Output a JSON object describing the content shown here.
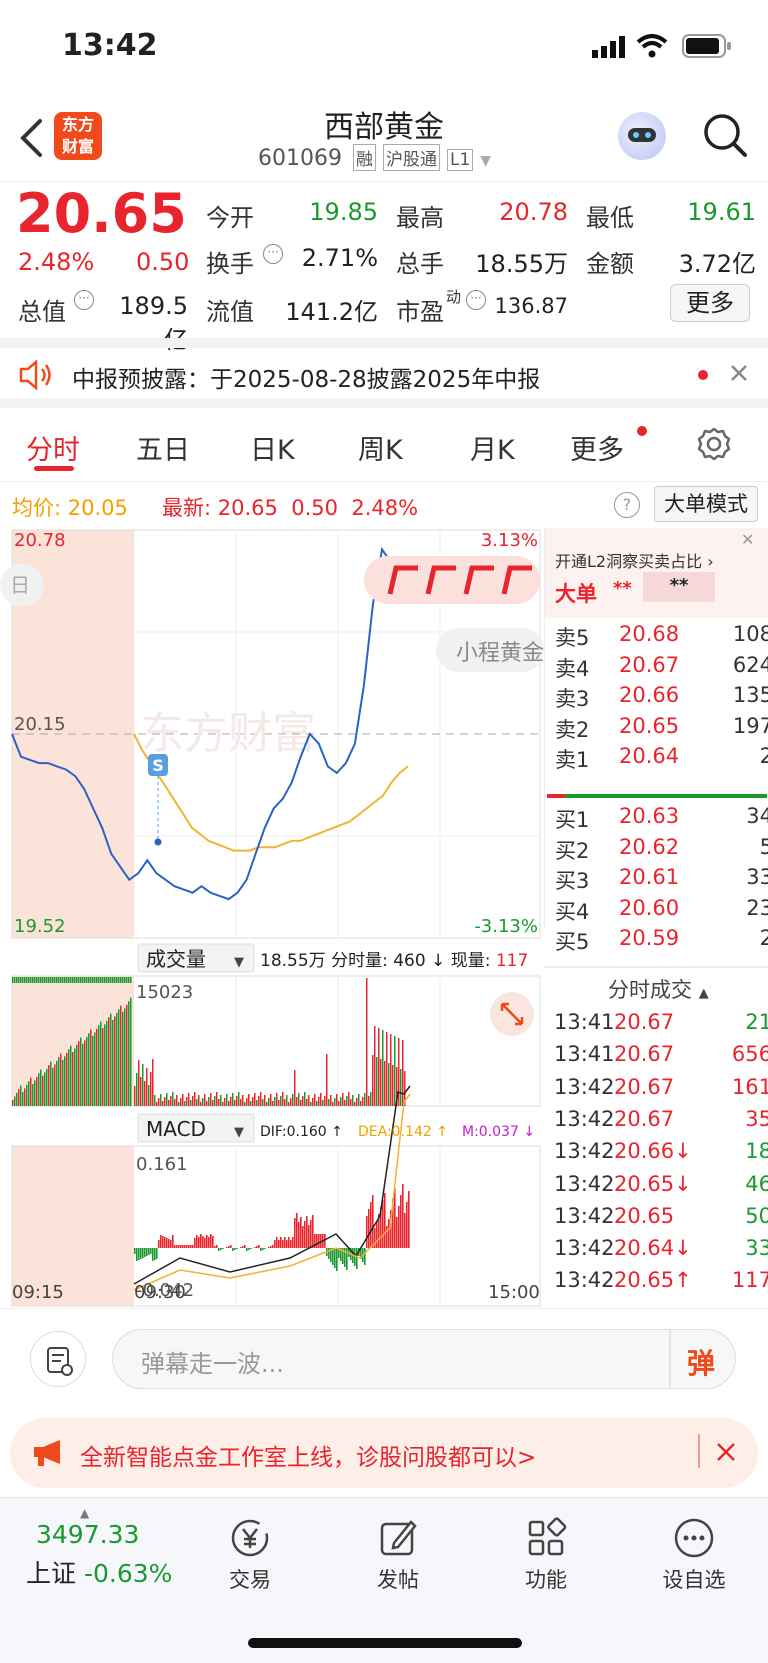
{
  "status": {
    "time": "13:42"
  },
  "nav": {
    "title": "西部黄金",
    "code": "601069",
    "tags": [
      "融",
      "沪股通",
      "L1"
    ],
    "logo_text_1": "东方",
    "logo_text_2": "财富"
  },
  "quote": {
    "price": "20.65",
    "change_pct": "2.48%",
    "change": "0.50",
    "open_label": "今开",
    "open": "19.85",
    "high_label": "最高",
    "high": "20.78",
    "low_label": "最低",
    "low": "19.61",
    "turnover_label": "换手",
    "turnover": "2.71%",
    "volume_label": "总手",
    "volume": "18.55万",
    "amount_label": "金额",
    "amount": "3.72亿",
    "mktcap_label": "总值",
    "mktcap": "189.5亿",
    "float_label": "流值",
    "float": "141.2亿",
    "pe_label": "市盈",
    "pe_sup": "动",
    "pe": "136.87",
    "more": "更多"
  },
  "notice": {
    "text": "中报预披露：于2025-08-28披露2025年中报"
  },
  "tabs": [
    "分时",
    "五日",
    "日K",
    "周K",
    "月K",
    "更多"
  ],
  "info": {
    "avg_label": "均价:",
    "avg": "20.05",
    "last_label": "最新:",
    "last": "20.65",
    "chg": "0.50",
    "pct": "2.48%",
    "mode": "大单模式"
  },
  "chart": {
    "y_top": "20.78",
    "y_mid": "20.15",
    "y_bot": "19.52",
    "pct_top": "3.13%",
    "pct_bot": "-3.13%",
    "badge": "S",
    "mini": "小程黄金",
    "watermark": "东方财富",
    "vol_select": "成交量",
    "vol_info": "18.55万 分时量: 460 ↓ 现量: ",
    "vol_now": "117",
    "vol_max": "15023",
    "macd_select": "MACD",
    "dif": "DIF:0.160 ↑",
    "dea": "DEA:0.142 ↑",
    "m": "M:0.037 ↓",
    "macd_top": "0.161",
    "macd_bot": "-0.042",
    "t_start": "09:15",
    "t_open": "09:30",
    "t_end": "15:00",
    "colors": {
      "price": "#2a63c5",
      "avg": "#f2b233",
      "up": "#e8242d",
      "down": "#1a9a2e"
    }
  },
  "chart_data": {
    "type": "line",
    "series": [
      {
        "values": [
          20.15,
          20.08,
          20.07,
          20.06,
          20.06,
          20.05,
          20.04,
          20.02,
          19.98,
          19.92,
          19.86,
          19.78,
          19.74,
          19.7,
          19.72,
          19.76,
          19.72,
          19.7,
          19.68,
          19.67,
          19.66,
          19.68,
          19.66,
          19.65,
          19.64,
          19.66,
          19.7,
          19.78,
          19.86,
          19.92,
          19.95,
          20.0,
          20.08,
          20.15,
          20.12,
          20.05,
          20.03,
          20.06,
          20.12,
          20.3,
          20.55,
          20.72,
          20.68,
          20.65
        ]
      },
      {
        "values": [
          20.15,
          20.1,
          20.06,
          20.02,
          19.98,
          19.94,
          19.9,
          19.86,
          19.84,
          19.82,
          19.81,
          19.8,
          19.79,
          19.79,
          19.79,
          19.8,
          19.8,
          19.8,
          19.81,
          19.82,
          19.82,
          19.83,
          19.84,
          19.85,
          19.86,
          19.87,
          19.88,
          19.9,
          19.92,
          19.94,
          19.96,
          20.0,
          20.03,
          20.05
        ]
      }
    ],
    "ylim": [
      19.52,
      20.78
    ]
  },
  "orderbook": {
    "header": "开通L2洞察买卖占比",
    "big_label": "大单",
    "big_a": "**",
    "big_b": "**",
    "asks": [
      {
        "label": "卖5",
        "price": "20.68",
        "vol": "108"
      },
      {
        "label": "卖4",
        "price": "20.67",
        "vol": "624"
      },
      {
        "label": "卖3",
        "price": "20.66",
        "vol": "135"
      },
      {
        "label": "卖2",
        "price": "20.65",
        "vol": "197"
      },
      {
        "label": "卖1",
        "price": "20.64",
        "vol": "2"
      }
    ],
    "bids": [
      {
        "label": "买1",
        "price": "20.63",
        "vol": "34"
      },
      {
        "label": "买2",
        "price": "20.62",
        "vol": "5"
      },
      {
        "label": "买3",
        "price": "20.61",
        "vol": "33"
      },
      {
        "label": "买4",
        "price": "20.60",
        "vol": "23"
      },
      {
        "label": "买5",
        "price": "20.59",
        "vol": "2"
      }
    ]
  },
  "trades": {
    "title": "分时成交",
    "rows": [
      {
        "time": "13:41",
        "price": "20.67",
        "vol": "21"
      },
      {
        "time": "13:41",
        "price": "20.67",
        "vol": "656"
      },
      {
        "time": "13:42",
        "price": "20.67",
        "vol": "161"
      },
      {
        "time": "13:42",
        "price": "20.67",
        "vol": "35"
      },
      {
        "time": "13:42",
        "price": "20.66↓",
        "vol": "18"
      },
      {
        "time": "13:42",
        "price": "20.65↓",
        "vol": "46"
      },
      {
        "time": "13:42",
        "price": "20.65",
        "vol": "50"
      },
      {
        "time": "13:42",
        "price": "20.64↓",
        "vol": "33"
      },
      {
        "time": "13:42",
        "price": "20.65↑",
        "vol": "117"
      }
    ]
  },
  "danmu": {
    "placeholder": "弹幕走一波...",
    "btn": "弹"
  },
  "banner": {
    "text": "全新智能点金工作室上线，诊股问股都可以>"
  },
  "bottom": {
    "index_value": "3497.33",
    "index_name": "上证",
    "index_pct": "-0.63%",
    "items": [
      "交易",
      "发帖",
      "功能",
      "设自选"
    ]
  }
}
